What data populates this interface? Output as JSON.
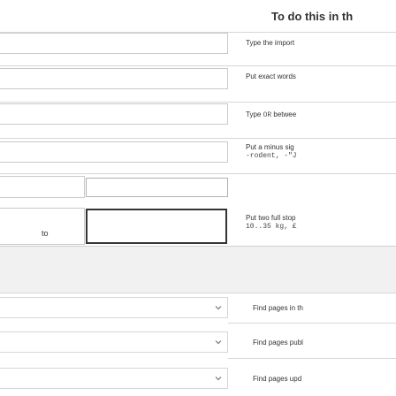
{
  "column_title": "To do this in th",
  "hints": [
    {
      "text": "Type the import",
      "mono": ""
    },
    {
      "text": "Put exact words",
      "mono": ""
    },
    {
      "text": "Type ",
      "kw": "OR",
      "rest": " betwee",
      "mono": ""
    },
    {
      "text": "Put a minus sig",
      "mono": "-rodent, -\"J"
    },
    {
      "text": "Put two full stop",
      "mono": "10..35 kg, £"
    }
  ],
  "range_label": "to",
  "find_items": [
    {
      "label": "Find pages in th"
    },
    {
      "label": "Find pages publ"
    },
    {
      "label": "Find pages upd"
    }
  ],
  "icons": {
    "dropdown": "chevron-down-icon"
  }
}
